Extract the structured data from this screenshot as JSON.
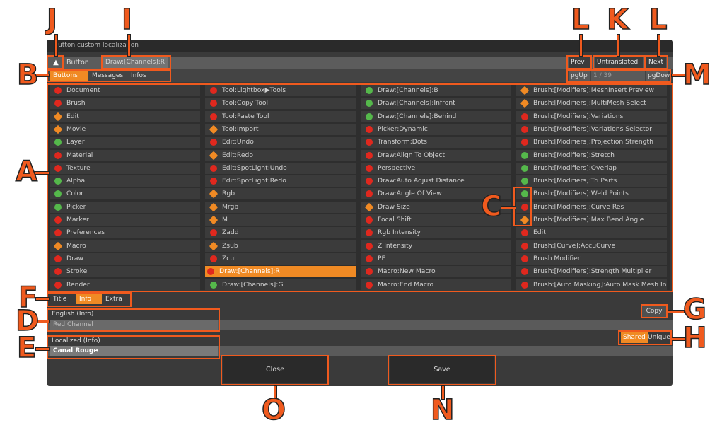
{
  "window": {
    "title": "Button custom localization"
  },
  "topbar": {
    "up_icon": "▲",
    "button_label": "Button",
    "current_key": "Draw:[Channels]:R",
    "prev": "Prev",
    "untranslated": "Untranslated",
    "next": "Next",
    "pgup": "pgUp",
    "page_indicator": "1 / 39",
    "pgdown": "pgDow"
  },
  "tabs": [
    "Buttons",
    "Messages",
    "Infos"
  ],
  "colors": {
    "accent": "#f08a24",
    "red": "#e0281e",
    "orange": "#f08a24",
    "green": "#55b84b"
  },
  "columns": [
    [
      {
        "label": "Document",
        "status": "red"
      },
      {
        "label": "Brush",
        "status": "red"
      },
      {
        "label": "Edit",
        "status": "orange"
      },
      {
        "label": "Movie",
        "status": "orange"
      },
      {
        "label": "Layer",
        "status": "green"
      },
      {
        "label": "Material",
        "status": "red"
      },
      {
        "label": "Texture",
        "status": "red"
      },
      {
        "label": "Alpha",
        "status": "green"
      },
      {
        "label": "Color",
        "status": "green"
      },
      {
        "label": "Picker",
        "status": "green"
      },
      {
        "label": "Marker",
        "status": "red"
      },
      {
        "label": "Preferences",
        "status": "red"
      },
      {
        "label": "Macro",
        "status": "orange"
      },
      {
        "label": "Draw",
        "status": "red"
      },
      {
        "label": "Stroke",
        "status": "red"
      },
      {
        "label": "Render",
        "status": "red"
      }
    ],
    [
      {
        "label": "Tool:Lightbox▶Tools",
        "status": "red"
      },
      {
        "label": "Tool:Copy Tool",
        "status": "red"
      },
      {
        "label": "Tool:Paste Tool",
        "status": "red"
      },
      {
        "label": "Tool:Import",
        "status": "orange"
      },
      {
        "label": "Edit:Undo",
        "status": "red"
      },
      {
        "label": "Edit:Redo",
        "status": "orange"
      },
      {
        "label": "Edit:SpotLight:Undo",
        "status": "red"
      },
      {
        "label": "Edit:SpotLight:Redo",
        "status": "red"
      },
      {
        "label": "Rgb",
        "status": "orange"
      },
      {
        "label": "Mrgb",
        "status": "orange"
      },
      {
        "label": "M",
        "status": "orange"
      },
      {
        "label": "Zadd",
        "status": "red"
      },
      {
        "label": "Zsub",
        "status": "orange"
      },
      {
        "label": "Zcut",
        "status": "red"
      },
      {
        "label": "Draw:[Channels]:R",
        "status": "red",
        "selected": true
      },
      {
        "label": "Draw:[Channels]:G",
        "status": "green"
      }
    ],
    [
      {
        "label": "Draw:[Channels]:B",
        "status": "green"
      },
      {
        "label": "Draw:[Channels]:Infront",
        "status": "green"
      },
      {
        "label": "Draw:[Channels]:Behind",
        "status": "green"
      },
      {
        "label": "Picker:Dynamic",
        "status": "red"
      },
      {
        "label": "Transform:Dots",
        "status": "red"
      },
      {
        "label": "Draw:Align To Object",
        "status": "red"
      },
      {
        "label": "Perspective",
        "status": "red"
      },
      {
        "label": "Draw:Auto Adjust Distance",
        "status": "red"
      },
      {
        "label": "Draw:Angle Of View",
        "status": "red"
      },
      {
        "label": "Draw Size",
        "status": "orange"
      },
      {
        "label": "Focal Shift",
        "status": "red"
      },
      {
        "label": "Rgb Intensity",
        "status": "red"
      },
      {
        "label": "Z Intensity",
        "status": "red"
      },
      {
        "label": "PF",
        "status": "red"
      },
      {
        "label": "Macro:New Macro",
        "status": "red"
      },
      {
        "label": "Macro:End Macro",
        "status": "red"
      }
    ],
    [
      {
        "label": "Brush:[Modifiers]:MeshInsert Preview",
        "status": "orange"
      },
      {
        "label": "Brush:[Modifiers]:MultiMesh Select",
        "status": "orange"
      },
      {
        "label": "Brush:[Modifiers]:Variations",
        "status": "red"
      },
      {
        "label": "Brush:[Modifiers]:Variations Selector",
        "status": "red"
      },
      {
        "label": "Brush:[Modifiers]:Projection Strength",
        "status": "red"
      },
      {
        "label": "Brush:[Modifiers]:Stretch",
        "status": "green"
      },
      {
        "label": "Brush:[Modifiers]:Overlap",
        "status": "green"
      },
      {
        "label": "Brush:[Modifiers]:Tri Parts",
        "status": "green"
      },
      {
        "label": "Brush:[Modifiers]:Weld Points",
        "status": "green"
      },
      {
        "label": "Brush:[Modifiers]:Curve Res",
        "status": "red"
      },
      {
        "label": "Brush:[Modifiers]:Max Bend Angle",
        "status": "orange"
      },
      {
        "label": "Edit",
        "status": "red"
      },
      {
        "label": "Brush:[Curve]:AccuCurve",
        "status": "red"
      },
      {
        "label": "Brush Modifier",
        "status": "red"
      },
      {
        "label": "Brush:[Modifiers]:Strength Multiplier",
        "status": "red"
      },
      {
        "label": "Brush:[Auto Masking]:Auto Mask Mesh Insert",
        "status": "red"
      }
    ]
  ],
  "subtabs": [
    "Title",
    "Info",
    "Extra"
  ],
  "copy_label": "Copy",
  "english": {
    "label": "English (Info)",
    "value": "Red Channel"
  },
  "localized": {
    "label": "Localized (Info)",
    "value": "Canal Rouge"
  },
  "mode": {
    "shared": "Shared",
    "unique": "Unique"
  },
  "buttons": {
    "close": "Close",
    "save": "Save"
  },
  "callout_letters": [
    "A",
    "B",
    "C",
    "D",
    "E",
    "F",
    "G",
    "H",
    "I",
    "J",
    "K",
    "L",
    "M",
    "N",
    "O"
  ]
}
